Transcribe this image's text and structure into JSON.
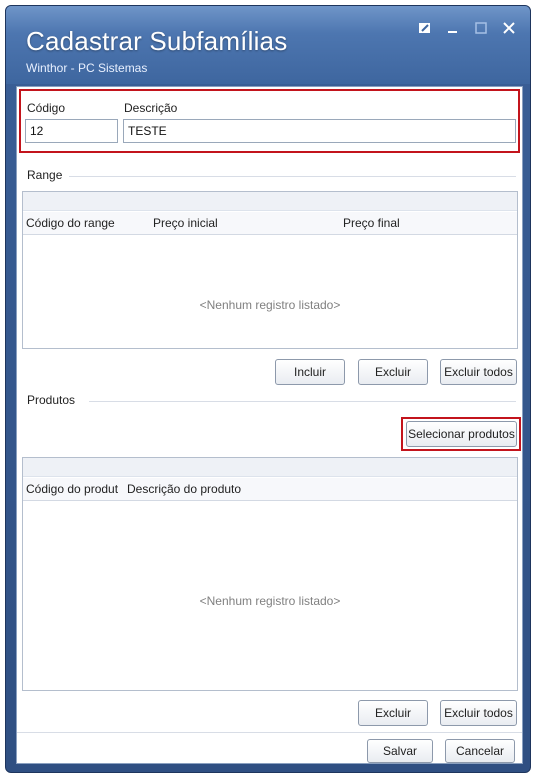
{
  "window": {
    "title": "Cadastrar Subfamílias",
    "subtitle": "Winthor - PC Sistemas",
    "buttons": [
      "help-icon",
      "minimize-icon",
      "maximize-icon",
      "close-icon"
    ]
  },
  "header_fields": {
    "codigo_label": "Código",
    "codigo_value": "12",
    "descricao_label": "Descrição",
    "descricao_value": "TESTE"
  },
  "range": {
    "title": "Range",
    "columns": [
      "Código do range",
      "Preço inicial",
      "Preço final"
    ],
    "empty_text": "<Nenhum registro listado>",
    "buttons": {
      "incluir": "Incluir",
      "excluir": "Excluir",
      "excluir_todos": "Excluir todos"
    }
  },
  "produtos": {
    "title": "Produtos",
    "select_button": "Selecionar produtos",
    "columns": [
      "Código do produt",
      "Descrição do produto"
    ],
    "empty_text": "<Nenhum registro listado>",
    "buttons": {
      "excluir": "Excluir",
      "excluir_todos": "Excluir todos"
    }
  },
  "footer": {
    "salvar": "Salvar",
    "cancelar": "Cancelar"
  },
  "colors": {
    "highlight": "#c3141c",
    "titlebar": "#4d76b0"
  }
}
